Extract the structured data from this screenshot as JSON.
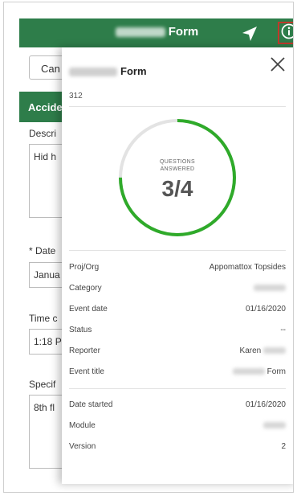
{
  "header": {
    "title": "Form",
    "colors": {
      "brand": "#2e7d4a",
      "highlight": "#c0392b"
    },
    "icons": {
      "navigate": "location-arrow-icon",
      "info": "info-icon"
    }
  },
  "form": {
    "cancel_label": "Can",
    "section_label": "Accide",
    "fields": [
      {
        "label": "Descri",
        "value": "Hid h"
      },
      {
        "label": "* Date",
        "value": "Janua"
      },
      {
        "label": "Time c",
        "value": "1:18 P"
      },
      {
        "label": "Specif",
        "value": "8th fl"
      }
    ]
  },
  "overlay": {
    "title": "Form",
    "record_id": "312",
    "close_icon": "close-icon",
    "progress": {
      "label_line1": "QUESTIONS",
      "label_line2": "ANSWERED",
      "text": "3/4",
      "answered": 3,
      "total": 4,
      "color": "#2faa2a"
    },
    "details": [
      {
        "key": "Proj/Org",
        "value": "Appomattox Topsides"
      },
      {
        "key": "Category",
        "value": ""
      },
      {
        "key": "Event date",
        "value": "01/16/2020"
      },
      {
        "key": "Status",
        "value": "--"
      },
      {
        "key": "Reporter",
        "value": "Karen"
      },
      {
        "key": "Event title",
        "value": "Form"
      }
    ],
    "meta": [
      {
        "key": "Date started",
        "value": "01/16/2020"
      },
      {
        "key": "Module",
        "value": ""
      },
      {
        "key": "Version",
        "value": "2"
      }
    ]
  }
}
